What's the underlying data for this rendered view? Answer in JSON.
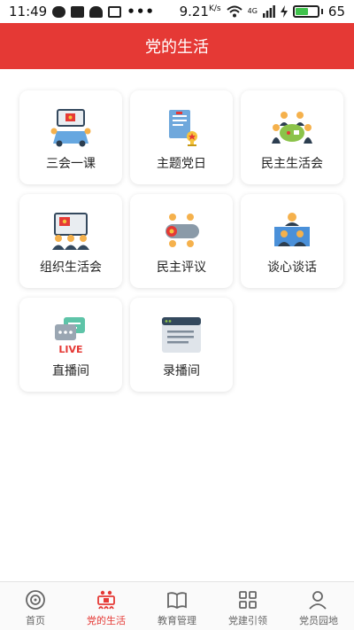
{
  "status_bar": {
    "time": "11:49",
    "more": "•••",
    "speed": "9.21",
    "speed_unit": "K/s",
    "signal": "4G",
    "battery": "65"
  },
  "header": {
    "title": "党的生活"
  },
  "tiles": [
    {
      "label": "三会一课",
      "icon": "meeting-icon"
    },
    {
      "label": "主题党日",
      "icon": "document-trophy-icon"
    },
    {
      "label": "民主生活会",
      "icon": "round-table-icon"
    },
    {
      "label": "组织生活会",
      "icon": "audience-icon"
    },
    {
      "label": "民主评议",
      "icon": "review-icon"
    },
    {
      "label": "谈心谈话",
      "icon": "talk-icon"
    },
    {
      "label": "直播间",
      "icon": "live-icon"
    },
    {
      "label": "录播间",
      "icon": "recording-icon"
    }
  ],
  "bottom_nav": [
    {
      "label": "首页",
      "icon": "home-icon",
      "active": false
    },
    {
      "label": "党的生活",
      "icon": "party-life-icon",
      "active": true
    },
    {
      "label": "教育管理",
      "icon": "book-icon",
      "active": false
    },
    {
      "label": "党建引领",
      "icon": "grid-icon",
      "active": false
    },
    {
      "label": "党员园地",
      "icon": "member-icon",
      "active": false
    }
  ],
  "colors": {
    "accent": "#e53935",
    "battery": "#3fc24b"
  }
}
